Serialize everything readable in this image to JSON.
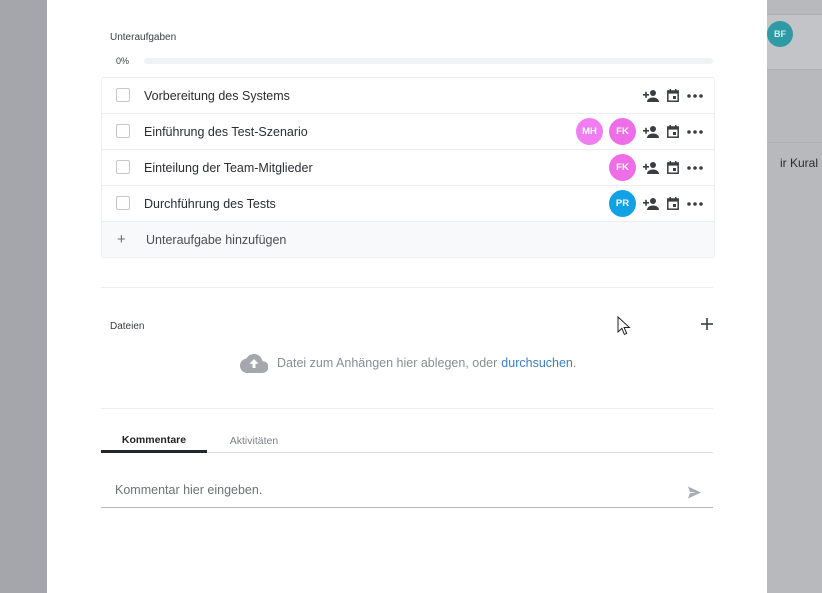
{
  "background": {
    "avatar_initials": "BF",
    "name_fragment": "ir Kural"
  },
  "subtasks": {
    "label": "Unteraufgaben",
    "progress": {
      "text": "0%",
      "value": 0
    },
    "items": [
      {
        "title": "Vorbereitung des Systems",
        "assignees": []
      },
      {
        "title": "Einführung des Test-Szenario",
        "assignees": [
          {
            "initials": "MH",
            "color": "#f07ef0"
          },
          {
            "initials": "FK",
            "color": "#ee6ee8"
          }
        ]
      },
      {
        "title": "Einteilung der Team-Mitglieder",
        "assignees": [
          {
            "initials": "FK",
            "color": "#ee6ee8"
          }
        ]
      },
      {
        "title": "Durchführung des Tests",
        "assignees": [
          {
            "initials": "PR",
            "color": "#13a1e6"
          }
        ]
      }
    ],
    "add_label": "Unteraufgabe hinzufügen",
    "add_icon": "+"
  },
  "files": {
    "label": "Dateien",
    "drop_text": "Datei zum Anhängen hier ablegen, oder",
    "browse_link": "durchsuchen",
    "period": "."
  },
  "tabs": [
    {
      "label": "Kommentare",
      "active": true
    },
    {
      "label": "Aktivitäten",
      "active": false
    }
  ],
  "comment": {
    "placeholder": "Kommentar hier eingeben."
  },
  "icons": {
    "assign": "person-add-icon",
    "date": "calendar-icon",
    "more": "more-horizontal-icon",
    "upload": "cloud-upload-icon",
    "send": "send-icon",
    "add_file": "plus-icon"
  }
}
